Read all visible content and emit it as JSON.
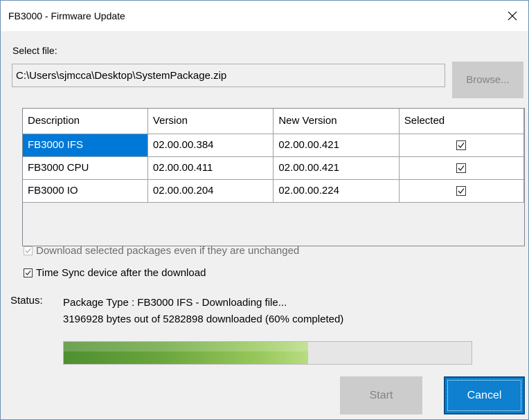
{
  "window": {
    "title": "FB3000 - Firmware Update"
  },
  "file": {
    "label": "Select file:",
    "path": "C:\\Users\\sjmcca\\Desktop\\SystemPackage.zip",
    "browse_label": "Browse..."
  },
  "table": {
    "headers": [
      "Description",
      "Version",
      "New Version",
      "Selected"
    ],
    "rows": [
      {
        "description": "FB3000 IFS",
        "version": "02.00.00.384",
        "new_version": "02.00.00.421",
        "selected": true
      },
      {
        "description": "FB3000 CPU",
        "version": "02.00.00.411",
        "new_version": "02.00.00.421",
        "selected": true
      },
      {
        "description": "FB3000 IO",
        "version": "02.00.00.204",
        "new_version": "02.00.00.224",
        "selected": true
      }
    ]
  },
  "options": {
    "download_unchanged": {
      "label": "Download selected packages even if they are unchanged",
      "checked": true,
      "enabled": false
    },
    "time_sync": {
      "label": "Time Sync device after the download",
      "checked": true,
      "enabled": true
    }
  },
  "status": {
    "label": "Status:",
    "line1": "Package Type : FB3000 IFS - Downloading file...",
    "line2": "3196928 bytes out of 5282898 downloaded (60% completed)"
  },
  "progress": {
    "fraction": 0.6
  },
  "buttons": {
    "start_label": "Start",
    "cancel_label": "Cancel"
  },
  "colors": {
    "selection": "#0078d7",
    "cancel_button": "#0e80cf",
    "progress_fill": "#6aa53d"
  }
}
